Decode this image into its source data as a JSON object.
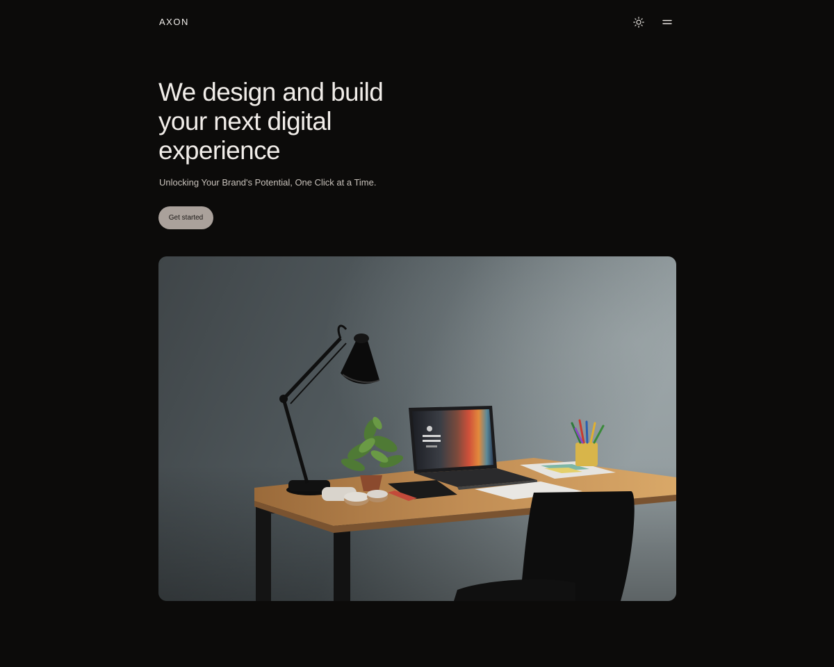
{
  "nav": {
    "logo": "AXON",
    "theme_toggle_icon": "sun-icon",
    "menu_icon": "hamburger-icon"
  },
  "hero": {
    "title_lines": [
      "We design and build",
      "your next digital",
      "experience"
    ],
    "subtitle": "Unlocking Your Brand's Potential, One Click at a Time.",
    "cta_label": "Get started"
  },
  "image": {
    "alt": "Desk with lamp, plant, laptop, notebooks, pencil cup and black chair against grey wall"
  },
  "colors": {
    "background": "#0c0b0a",
    "text": "#f1ede9",
    "button_bg": "#aaa19b",
    "button_text": "#1a1715"
  }
}
